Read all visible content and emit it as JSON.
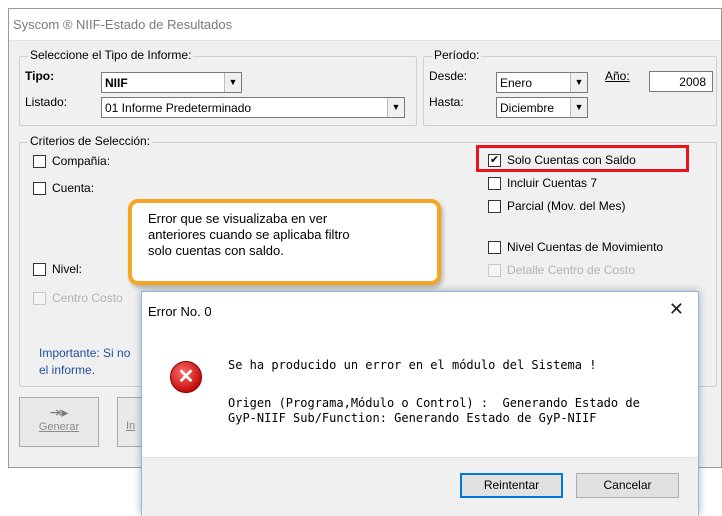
{
  "window": {
    "title": "Syscom ® NIIF-Estado de Resultados"
  },
  "report_type": {
    "legend": "Seleccione el Tipo de Informe:",
    "tipo_label": "Tipo:",
    "tipo_value": "NIIF",
    "listado_label": "Listado:",
    "listado_value": "01 Informe Predeterminado"
  },
  "period": {
    "legend": "Período:",
    "desde_label": "Desde:",
    "desde_value": "Enero",
    "hasta_label": "Hasta:",
    "hasta_value": "Diciembre",
    "anio_label": "Año:",
    "anio_value": "2008"
  },
  "criteria": {
    "legend": "Criterios de Selección:",
    "compania": "Compañia:",
    "cuenta": "Cuenta:",
    "nivel": "Nivel:",
    "centro_costo": "Centro Costo",
    "solo_cuentas": "Solo Cuentas con Saldo",
    "incluir_cuentas": "Incluir Cuentas 7",
    "parcial": "Parcial (Mov. del Mes)",
    "nivel_cuentas": "Nivel Cuentas de Movimiento",
    "detalle_centro": "Detalle Centro de Costo",
    "check_mark": "✔"
  },
  "callout": {
    "text_line1": "Error que se visualizaba en ver",
    "text_line2": "anteriores cuando se aplicaba filtro",
    "text_line3": "solo cuentas con saldo."
  },
  "note": {
    "line1": "Importante: Si no",
    "line2": "el informe."
  },
  "buttons": {
    "generar": "Generar",
    "second_partial": "In"
  },
  "dialog": {
    "title": "Error No. 0",
    "close": "✕",
    "icon_glyph": "✕",
    "message1": "Se ha producido un error en el módulo del Sistema !",
    "message2_line1": "Origen (Programa,Módulo o Control) :  Generando Estado de",
    "message2_line2": "GyP-NIIF Sub/Function: Generando Estado de GyP-NIIF",
    "retry": "Reintentar",
    "cancel": "Cancelar"
  },
  "colors": {
    "highlight": "#e8131b",
    "callout_border": "#f5a623",
    "note_text": "#1f4f9e"
  }
}
